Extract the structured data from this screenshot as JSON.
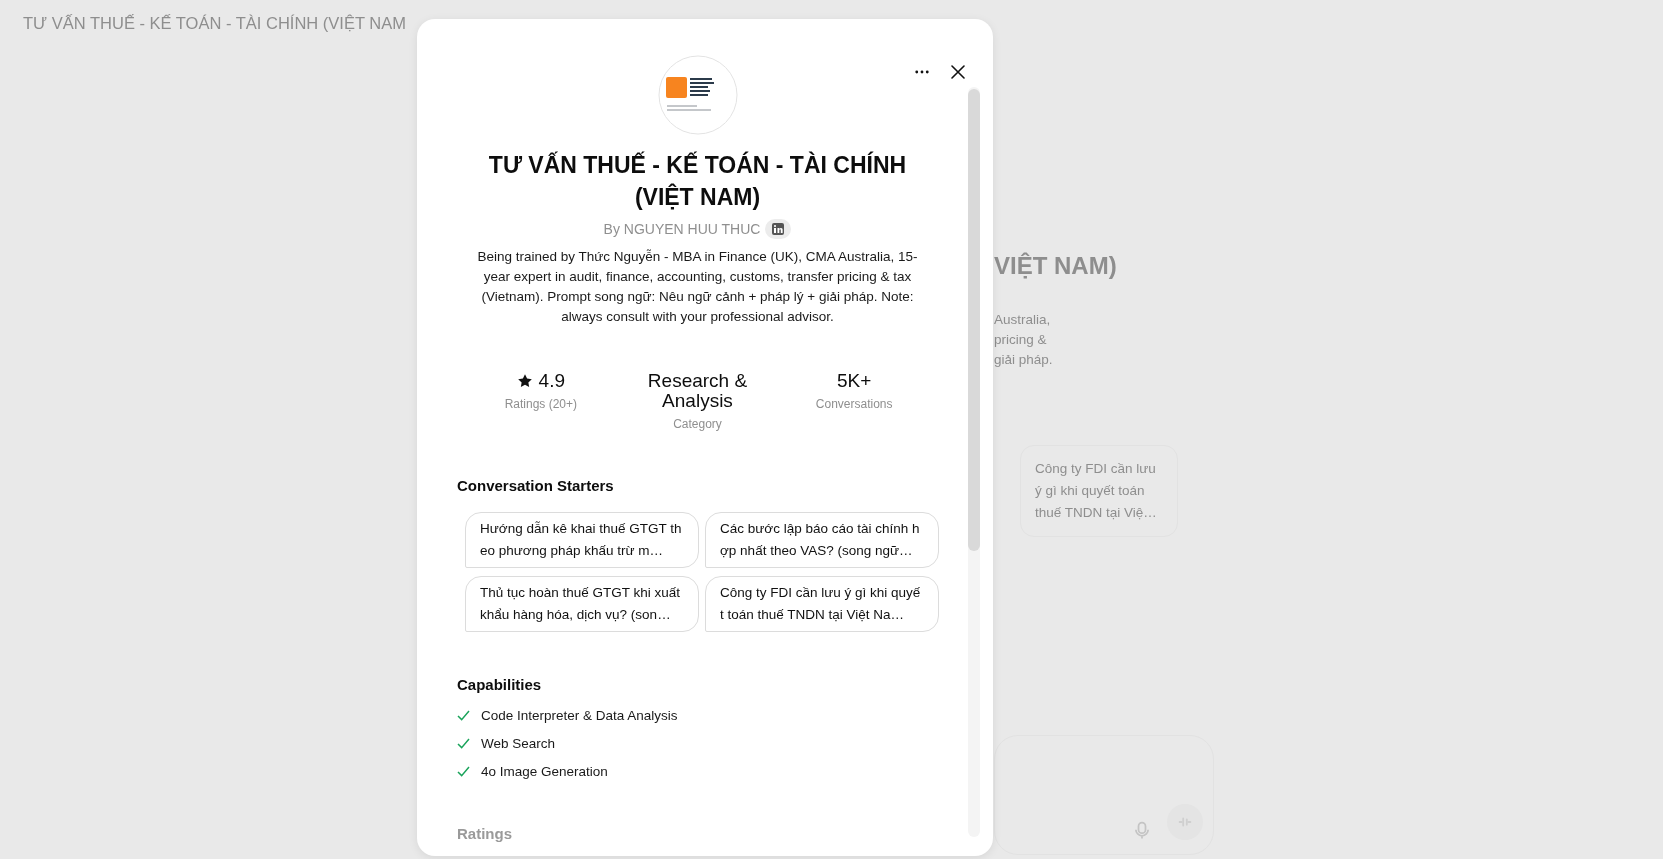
{
  "background": {
    "header_title": "TƯ VẤN THUẾ - KẾ TOÁN - TÀI CHÍNH (VIỆT NAM",
    "title_fragment": "VIỆT NAM)",
    "description_fragments": [
      "Australia,",
      "pricing &",
      "giải pháp."
    ],
    "starter_card": "Công ty FDI cần lưu ý gì khi quyết toán thuế TNDN tại Việ…"
  },
  "dialog": {
    "title": "TƯ VẤN THUẾ - KẾ TOÁN - TÀI CHÍNH (VIỆT NAM)",
    "author": "By NGUYEN HUU THUC",
    "description": "Being trained by Thức Nguyễn - MBA in Finance (UK), CMA Australia, 15-year expert in audit, finance, accounting, customs, transfer pricing & tax (Vietnam). Prompt song ngữ: Nêu ngữ cảnh + pháp lý + giải pháp. Note: always consult with your professional advisor.",
    "stats": [
      {
        "kind": "rating",
        "value": "4.9",
        "label": "Ratings (20+)"
      },
      {
        "kind": "text",
        "value": "Research & Analysis",
        "label": "Category"
      },
      {
        "kind": "text",
        "value": "5K+",
        "label": "Conversations"
      }
    ],
    "starters_heading": "Conversation Starters",
    "starters": [
      "Hướng dẫn kê khai thuế GTGT theo phương pháp khấu trừ m…",
      "Các bước lập báo cáo tài chính hợp nhất theo VAS? (song ngữ…",
      "Thủ tục hoàn thuế GTGT khi xuất khẩu hàng hóa, dịch vụ? (son…",
      "Công ty FDI cần lưu ý gì khi quyết toán thuế TNDN tại Việt Na…"
    ],
    "capabilities_heading": "Capabilities",
    "capabilities": [
      {
        "label": "Code Interpreter & Data Analysis",
        "checked": true
      },
      {
        "label": "Web Search",
        "checked": true
      },
      {
        "label": "4o Image Generation",
        "checked": true
      }
    ],
    "ratings_heading": "Ratings"
  }
}
